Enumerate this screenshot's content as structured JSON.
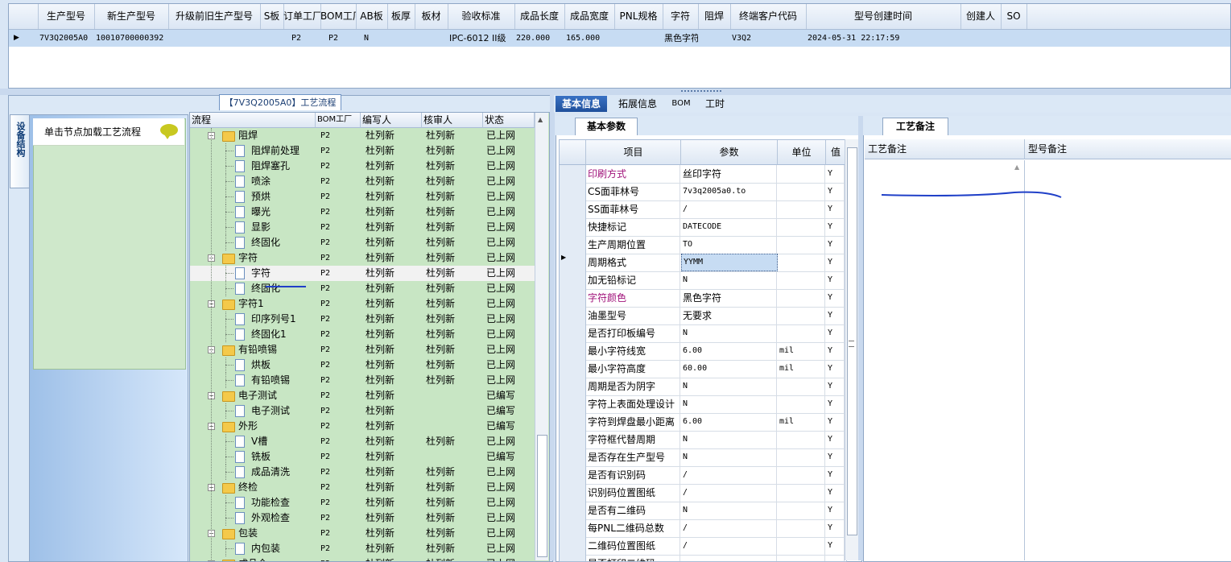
{
  "top_grid": {
    "columns": [
      "生产型号",
      "新生产型号",
      "升级前旧生产型号",
      "S板",
      "订单工厂",
      "BOM工厂",
      "AB板",
      "板厚",
      "板材",
      "验收标准",
      "成品长度",
      "成品宽度",
      "PNL规格",
      "字符",
      "阻焊",
      "终端客户代码",
      "型号创建时间",
      "创建人",
      "SO"
    ],
    "row": [
      "7V3Q2005A0",
      "10010700000392",
      "",
      "",
      "P2",
      "P2",
      "N",
      "",
      "",
      "IPC-6012 II级",
      "220.000",
      "165.000",
      "",
      "黑色字符",
      "",
      "V3Q2",
      "2024-05-31 22:17:59",
      "",
      ""
    ]
  },
  "left": {
    "vertical_tab": "设备结构",
    "hint": "单击节点加载工艺流程",
    "flow_title": "【7V3Q2005A0】工艺流程",
    "tree_columns": [
      "流程",
      "BOM工厂",
      "编写人",
      "核审人",
      "状态"
    ],
    "tree_rows": [
      {
        "name": "阻焊",
        "level": 0,
        "bom": "P2",
        "writer": "杜列新",
        "reviewer": "杜列新",
        "status": "已上网"
      },
      {
        "name": "阻焊前处理",
        "level": 1,
        "bom": "P2",
        "writer": "杜列新",
        "reviewer": "杜列新",
        "status": "已上网"
      },
      {
        "name": "阻焊塞孔",
        "level": 1,
        "bom": "P2",
        "writer": "杜列新",
        "reviewer": "杜列新",
        "status": "已上网"
      },
      {
        "name": "喷涂",
        "level": 1,
        "bom": "P2",
        "writer": "杜列新",
        "reviewer": "杜列新",
        "status": "已上网"
      },
      {
        "name": "预烘",
        "level": 1,
        "bom": "P2",
        "writer": "杜列新",
        "reviewer": "杜列新",
        "status": "已上网"
      },
      {
        "name": "曝光",
        "level": 1,
        "bom": "P2",
        "writer": "杜列新",
        "reviewer": "杜列新",
        "status": "已上网"
      },
      {
        "name": "显影",
        "level": 1,
        "bom": "P2",
        "writer": "杜列新",
        "reviewer": "杜列新",
        "status": "已上网"
      },
      {
        "name": "终固化",
        "level": 1,
        "bom": "P2",
        "writer": "杜列新",
        "reviewer": "杜列新",
        "status": "已上网"
      },
      {
        "name": "字符",
        "level": 0,
        "bom": "P2",
        "writer": "杜列新",
        "reviewer": "杜列新",
        "status": "已上网"
      },
      {
        "name": "字符",
        "level": 1,
        "bom": "P2",
        "writer": "杜列新",
        "reviewer": "杜列新",
        "status": "已上网"
      },
      {
        "name": "终固化",
        "level": 1,
        "bom": "P2",
        "writer": "杜列新",
        "reviewer": "杜列新",
        "status": "已上网"
      },
      {
        "name": "字符1",
        "level": 0,
        "bom": "P2",
        "writer": "杜列新",
        "reviewer": "杜列新",
        "status": "已上网"
      },
      {
        "name": "印序列号1",
        "level": 1,
        "bom": "P2",
        "writer": "杜列新",
        "reviewer": "杜列新",
        "status": "已上网"
      },
      {
        "name": "终固化1",
        "level": 1,
        "bom": "P2",
        "writer": "杜列新",
        "reviewer": "杜列新",
        "status": "已上网"
      },
      {
        "name": "有铅喷锡",
        "level": 0,
        "bom": "P2",
        "writer": "杜列新",
        "reviewer": "杜列新",
        "status": "已上网"
      },
      {
        "name": "烘板",
        "level": 1,
        "bom": "P2",
        "writer": "杜列新",
        "reviewer": "杜列新",
        "status": "已上网"
      },
      {
        "name": "有铅喷锡",
        "level": 1,
        "bom": "P2",
        "writer": "杜列新",
        "reviewer": "杜列新",
        "status": "已上网"
      },
      {
        "name": "电子测试",
        "level": 0,
        "bom": "P2",
        "writer": "杜列新",
        "reviewer": "",
        "status": "已编写"
      },
      {
        "name": "电子测试",
        "level": 1,
        "bom": "P2",
        "writer": "杜列新",
        "reviewer": "",
        "status": "已编写"
      },
      {
        "name": "外形",
        "level": 0,
        "bom": "P2",
        "writer": "杜列新",
        "reviewer": "",
        "status": "已编写"
      },
      {
        "name": "V槽",
        "level": 1,
        "bom": "P2",
        "writer": "杜列新",
        "reviewer": "杜列新",
        "status": "已上网"
      },
      {
        "name": "铣板",
        "level": 1,
        "bom": "P2",
        "writer": "杜列新",
        "reviewer": "",
        "status": "已编写"
      },
      {
        "name": "成品清洗",
        "level": 1,
        "bom": "P2",
        "writer": "杜列新",
        "reviewer": "杜列新",
        "status": "已上网"
      },
      {
        "name": "终检",
        "level": 0,
        "bom": "P2",
        "writer": "杜列新",
        "reviewer": "杜列新",
        "status": "已上网"
      },
      {
        "name": "功能检查",
        "level": 1,
        "bom": "P2",
        "writer": "杜列新",
        "reviewer": "杜列新",
        "status": "已上网"
      },
      {
        "name": "外观检查",
        "level": 1,
        "bom": "P2",
        "writer": "杜列新",
        "reviewer": "杜列新",
        "status": "已上网"
      },
      {
        "name": "包装",
        "level": 0,
        "bom": "P2",
        "writer": "杜列新",
        "reviewer": "杜列新",
        "status": "已上网"
      },
      {
        "name": "内包装",
        "level": 1,
        "bom": "P2",
        "writer": "杜列新",
        "reviewer": "杜列新",
        "status": "已上网"
      },
      {
        "name": "成品仓",
        "level": 0,
        "bom": "P2",
        "writer": "杜列新",
        "reviewer": "杜列新",
        "status": "已上网"
      }
    ]
  },
  "right": {
    "tabs": [
      "基本信息",
      "拓展信息",
      "BOM",
      "工时"
    ],
    "basic_subtab": "基本参数",
    "param_columns": [
      "项目",
      "参数",
      "单位",
      "值"
    ],
    "params": [
      {
        "item": "印刷方式",
        "value": "丝印字符",
        "unit": "",
        "flag": "Y",
        "highlight": true
      },
      {
        "item": "CS面菲林号",
        "value": "7v3q2005a0.to",
        "unit": "",
        "flag": "Y",
        "highlight": false
      },
      {
        "item": "SS面菲林号",
        "value": "/",
        "unit": "",
        "flag": "Y",
        "highlight": false
      },
      {
        "item": "快捷标记",
        "value": "DATECODE",
        "unit": "",
        "flag": "Y",
        "highlight": false
      },
      {
        "item": "生产周期位置",
        "value": "TO",
        "unit": "",
        "flag": "Y",
        "highlight": false
      },
      {
        "item": "周期格式",
        "value": "YYMM",
        "unit": "",
        "flag": "Y",
        "highlight": false
      },
      {
        "item": "加无铅标记",
        "value": "N",
        "unit": "",
        "flag": "Y",
        "highlight": false
      },
      {
        "item": "字符颜色",
        "value": "黑色字符",
        "unit": "",
        "flag": "Y",
        "highlight": true
      },
      {
        "item": "油墨型号",
        "value": "无要求",
        "unit": "",
        "flag": "Y",
        "highlight": false
      },
      {
        "item": "是否打印板编号",
        "value": "N",
        "unit": "",
        "flag": "Y",
        "highlight": false
      },
      {
        "item": "最小字符线宽",
        "value": "6.00",
        "unit": "mil",
        "flag": "Y",
        "highlight": false
      },
      {
        "item": "最小字符高度",
        "value": "60.00",
        "unit": "mil",
        "flag": "Y",
        "highlight": false
      },
      {
        "item": "周期是否为阴字",
        "value": "N",
        "unit": "",
        "flag": "Y",
        "highlight": false
      },
      {
        "item": "字符上表面处理设计",
        "value": "N",
        "unit": "",
        "flag": "Y",
        "highlight": false
      },
      {
        "item": "字符到焊盘最小距离",
        "value": "6.00",
        "unit": "mil",
        "flag": "Y",
        "highlight": false
      },
      {
        "item": "字符框代替周期",
        "value": "N",
        "unit": "",
        "flag": "Y",
        "highlight": false
      },
      {
        "item": "是否存在生产型号",
        "value": "N",
        "unit": "",
        "flag": "Y",
        "highlight": false
      },
      {
        "item": "是否有识别码",
        "value": "/",
        "unit": "",
        "flag": "Y",
        "highlight": false
      },
      {
        "item": "识别码位置图纸",
        "value": "/",
        "unit": "",
        "flag": "Y",
        "highlight": false
      },
      {
        "item": "是否有二维码",
        "value": "N",
        "unit": "",
        "flag": "Y",
        "highlight": false
      },
      {
        "item": "每PNL二维码总数",
        "value": "/",
        "unit": "",
        "flag": "Y",
        "highlight": false
      },
      {
        "item": "二维码位置图纸",
        "value": "/",
        "unit": "",
        "flag": "Y",
        "highlight": false
      },
      {
        "item": "是否打印二维码",
        "value": "",
        "unit": "",
        "flag": "",
        "highlight": false
      }
    ],
    "notes_subtab": "工艺备注",
    "notes_columns": [
      "工艺备注",
      "型号备注"
    ]
  },
  "colors": {
    "highlight_text": "#a0127a",
    "tree_bg": "#c8e6c4",
    "selected_row": "#c7dcf3",
    "accent": "#1f4f9b"
  }
}
